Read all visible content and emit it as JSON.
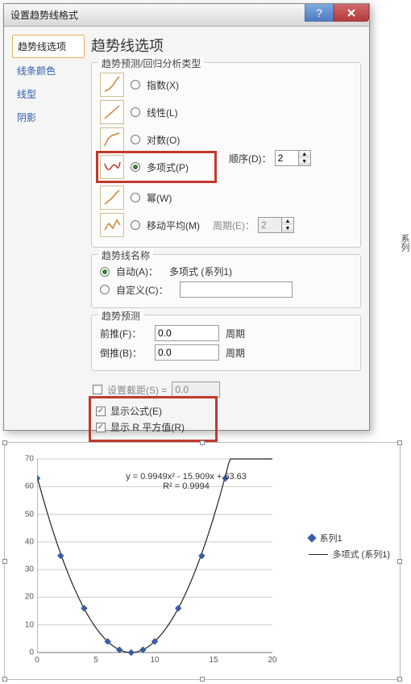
{
  "dialog": {
    "title": "设置趋势线格式",
    "nav": {
      "options": "趋势线选项",
      "line_color": "线条颜色",
      "line_style": "线型",
      "shadow": "阴影"
    },
    "heading": "趋势线选项",
    "type_group": {
      "legend": "趋势预测/回归分析类型",
      "exponential": "指数(X)",
      "linear": "线性(L)",
      "logarithmic": "对数(O)",
      "polynomial": "多项式(P)",
      "power": "幂(W)",
      "moving_avg": "移动平均(M)",
      "order_label": "顺序(D)：",
      "order_value": "2",
      "period_label": "周期(E)：",
      "period_value": "2"
    },
    "name_group": {
      "legend": "趋势线名称",
      "auto": "自动(A)：",
      "auto_value": "多项式 (系列1)",
      "custom": "自定义(C)："
    },
    "forecast_group": {
      "legend": "趋势预测",
      "forward": "前推(F)：",
      "forward_value": "0.0",
      "backward": "倒推(B)：",
      "backward_value": "0.0",
      "unit": "周期"
    },
    "intercept": {
      "label": "设置截距(S) =",
      "value": "0.0"
    },
    "show_equation": "显示公式(E)",
    "show_r2": "显示 R 平方值(R)"
  },
  "side_label": "系列",
  "chart_data": {
    "type": "scatter",
    "x": [
      0,
      2,
      4,
      6,
      7,
      8,
      9,
      10,
      12,
      14,
      16
    ],
    "y": [
      63,
      35,
      16,
      4,
      1,
      0,
      1,
      4,
      16,
      35,
      63
    ],
    "equation": "y = 0.9949x² - 15.909x + 63.63",
    "r2": "R² = 0.9994",
    "xlim": [
      0,
      20
    ],
    "ylim": [
      0,
      70
    ],
    "xticks": [
      0,
      5,
      10,
      15,
      20
    ],
    "yticks": [
      0,
      10,
      20,
      30,
      40,
      50,
      60,
      70
    ],
    "legend": {
      "series": "系列1",
      "trendline": "多项式 (系列1)"
    }
  }
}
